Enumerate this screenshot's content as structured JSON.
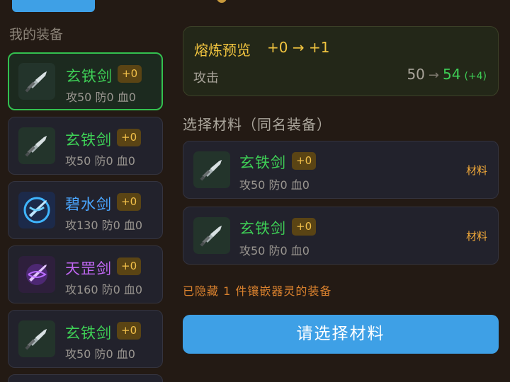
{
  "sidebar": {
    "title": "我的装备",
    "items": [
      {
        "name": "玄铁剑",
        "level": "+0",
        "stats": "攻50 防0 血0",
        "rarity": "green",
        "icon": "sword-icon"
      },
      {
        "name": "玄铁剑",
        "level": "+0",
        "stats": "攻50 防0 血0",
        "rarity": "green",
        "icon": "sword-icon"
      },
      {
        "name": "碧水剑",
        "level": "+0",
        "stats": "攻130 防0 血0",
        "rarity": "blue",
        "icon": "water-sword-icon"
      },
      {
        "name": "天罡剑",
        "level": "+0",
        "stats": "攻160 防0 血0",
        "rarity": "purple",
        "icon": "purple-sword-icon"
      },
      {
        "name": "玄铁剑",
        "level": "+0",
        "stats": "攻50 防0 血0",
        "rarity": "green",
        "icon": "sword-icon"
      }
    ]
  },
  "preview": {
    "title": "熔炼预览",
    "level_change": "+0 → +1",
    "stat_label": "攻击",
    "old_value": "50",
    "arrow": "→",
    "new_value": "54",
    "diff": "(+4)"
  },
  "materials": {
    "title": "选择材料（同名装备）",
    "items": [
      {
        "name": "玄铁剑",
        "level": "+0",
        "stats": "攻50 防0 血0",
        "tag": "材料",
        "icon": "sword-icon"
      },
      {
        "name": "玄铁剑",
        "level": "+0",
        "stats": "攻50 防0 血0",
        "tag": "材料",
        "icon": "sword-icon"
      }
    ],
    "hidden_note": "已隐藏 1 件镶嵌器灵的装备"
  },
  "confirm_button": "请选择材料",
  "colors": {
    "accent": "#3ea0e6",
    "green": "#3ecf56",
    "gold": "#f1c43f",
    "blue": "#4aa6ff",
    "purple": "#c067f2"
  }
}
